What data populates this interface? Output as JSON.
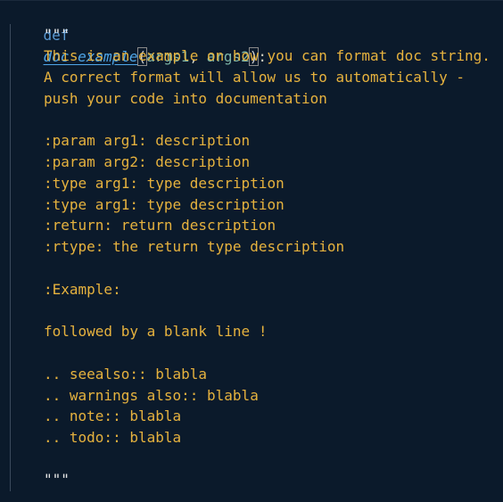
{
  "code": {
    "def_keyword": "def",
    "function_name": "doc_example",
    "open_paren": "(",
    "param1": "args1",
    "comma": ", ",
    "param2": "args2",
    "close_paren": ")",
    "colon": ":",
    "docstring_open": "\"\"\"",
    "docstring_close": "\"\"\"",
    "doc_lines": [
      "This is an example on how you can format doc string.",
      "A correct format will allow us to automatically -",
      "push your code into documentation",
      "",
      ":param arg1: description",
      ":param arg2: description",
      ":type arg1: type description",
      ":type arg1: type description",
      ":return: return description",
      ":rtype: the return type description",
      "",
      ":Example:",
      "",
      "followed by a blank line !",
      "",
      ".. seealso:: blabla",
      ".. warnings also:: blabla",
      ".. note:: blabla",
      ".. todo:: blabla",
      ""
    ]
  },
  "colors": {
    "background": "#0b1a2b",
    "keyword": "#5b9bd5",
    "function": "#4fa6e8",
    "parameter": "#7eb6a8",
    "docstring": "#e6b23e"
  }
}
